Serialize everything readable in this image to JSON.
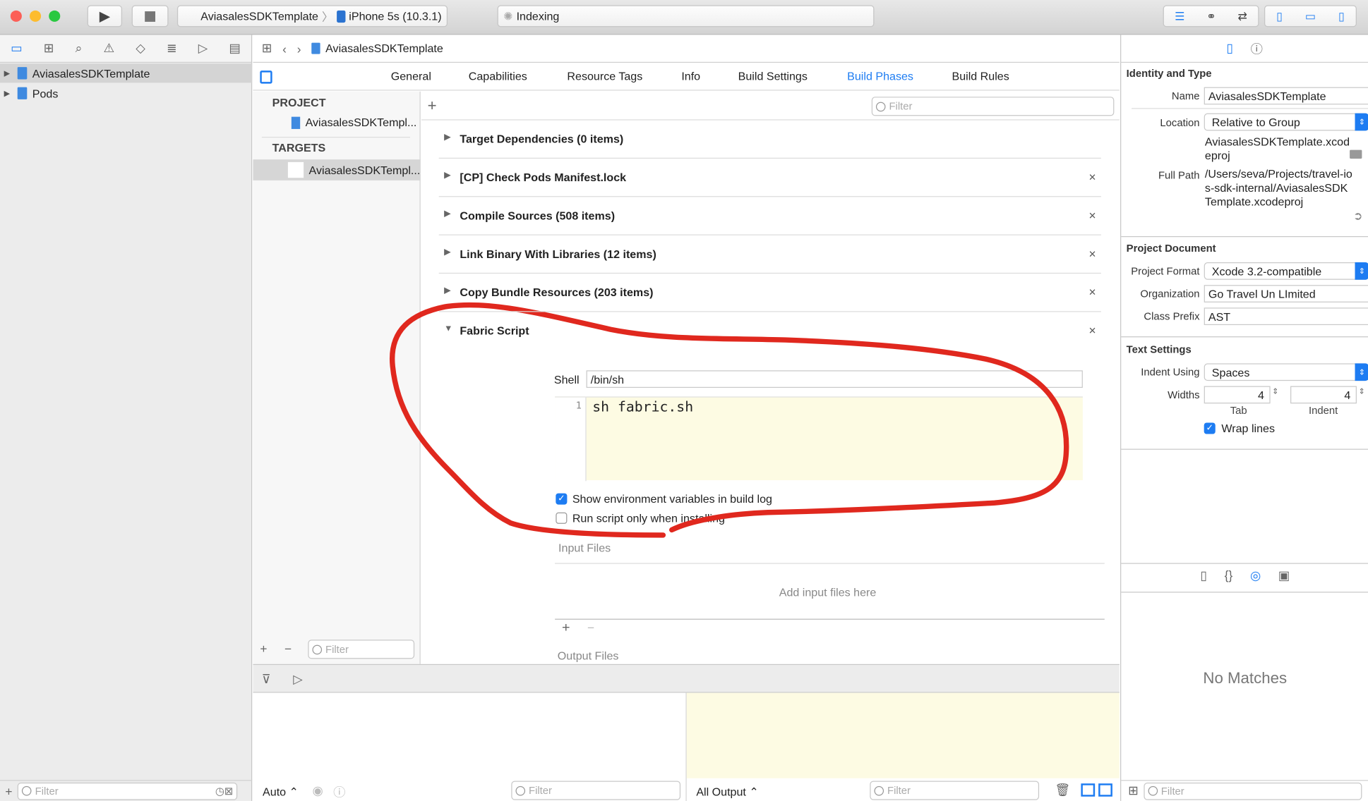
{
  "toolbar": {
    "scheme": "AviasalesSDKTemplate",
    "device": "iPhone 5s (10.3.1)",
    "activity": "Indexing"
  },
  "breadcrumb": {
    "project": "AviasalesSDKTemplate"
  },
  "navigator": {
    "items": [
      {
        "label": "AviasalesSDKTemplate",
        "selected": true
      },
      {
        "label": "Pods"
      }
    ],
    "filter_placeholder": "Filter"
  },
  "tabs": [
    {
      "label": "General"
    },
    {
      "label": "Capabilities"
    },
    {
      "label": "Resource Tags"
    },
    {
      "label": "Info"
    },
    {
      "label": "Build Settings"
    },
    {
      "label": "Build Phases",
      "active": true
    },
    {
      "label": "Build Rules"
    }
  ],
  "targets_list": {
    "project_header": "PROJECT",
    "project_item": "AviasalesSDKTempl...",
    "targets_header": "TARGETS",
    "target_item": "AviasalesSDKTempl...",
    "filter_placeholder": "Filter"
  },
  "phases": {
    "filter_placeholder": "Filter",
    "items": [
      {
        "label": "Target Dependencies (0 items)",
        "expanded": false,
        "removable": false
      },
      {
        "label": "[CP] Check Pods Manifest.lock",
        "expanded": false,
        "removable": true
      },
      {
        "label": "Compile Sources (508 items)",
        "expanded": false,
        "removable": true
      },
      {
        "label": "Link Binary With Libraries (12 items)",
        "expanded": false,
        "removable": true
      },
      {
        "label": "Copy Bundle Resources (203 items)",
        "expanded": false,
        "removable": true
      },
      {
        "label": "Fabric Script",
        "expanded": true,
        "removable": true
      }
    ],
    "script": {
      "shell_label": "Shell",
      "shell": "/bin/sh",
      "line_number": "1",
      "code": "sh fabric.sh",
      "show_env_label": "Show environment variables in build log",
      "show_env": true,
      "run_install_label": "Run script only when installing",
      "run_install": false,
      "input_files_label": "Input Files",
      "input_placeholder": "Add input files here",
      "output_files_label": "Output Files"
    }
  },
  "debug": {
    "auto_label": "Auto ⌃",
    "filter_placeholder": "Filter",
    "output_label": "All Output ⌃"
  },
  "inspector": {
    "identity_header": "Identity and Type",
    "name_label": "Name",
    "name": "AviasalesSDKTemplate",
    "location_label": "Location",
    "location": "Relative to Group",
    "file_name": "AviasalesSDKTemplate.xcodeproj",
    "full_path_label": "Full Path",
    "full_path": "/Users/seva/Projects/travel-ios-sdk-internal/AviasalesSDKTemplate.xcodeproj",
    "project_doc_header": "Project Document",
    "format_label": "Project Format",
    "format": "Xcode 3.2-compatible",
    "org_label": "Organization",
    "org": "Go Travel Un LImited",
    "prefix_label": "Class Prefix",
    "prefix": "AST",
    "text_header": "Text Settings",
    "indent_using_label": "Indent Using",
    "indent_using": "Spaces",
    "widths_label": "Widths",
    "tab_width": "4",
    "indent_width": "4",
    "tab_label": "Tab",
    "indent_label": "Indent",
    "wrap_label": "Wrap lines",
    "wrap": true,
    "no_matches": "No Matches",
    "filter_placeholder": "Filter"
  },
  "colors": {
    "accent": "#1d7cf2",
    "annotation": "#e0281e",
    "script_bg": "#fdfbe3"
  }
}
